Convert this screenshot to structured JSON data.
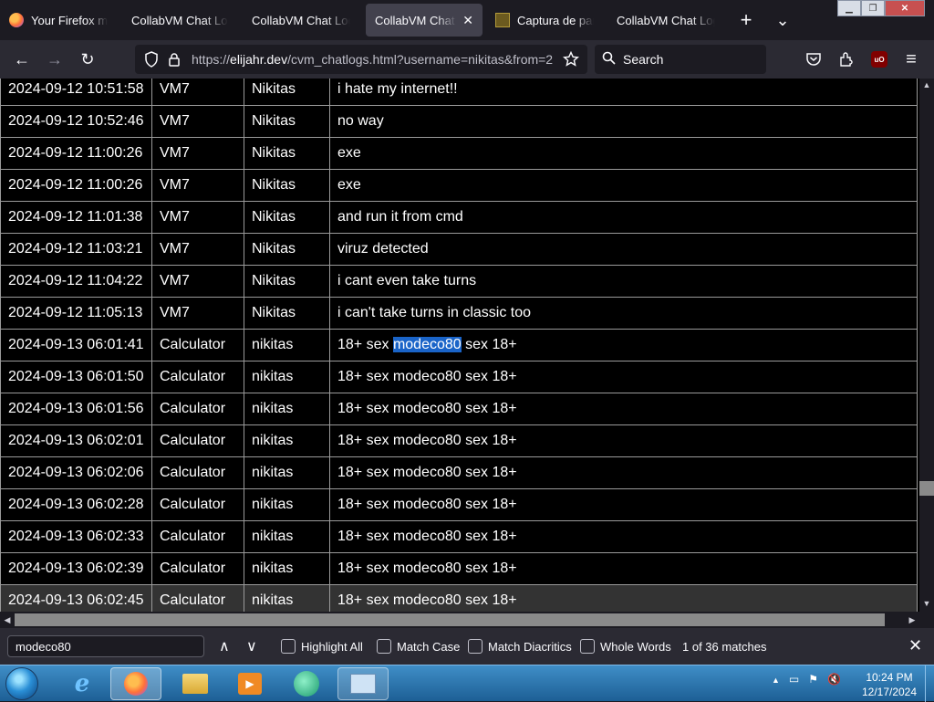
{
  "window": {
    "minimize_glyph": "▁",
    "restore_glyph": "❐",
    "close_glyph": "✕"
  },
  "tabs": [
    {
      "label": "Your Firefox may",
      "icon": "firefox-icon",
      "active": false
    },
    {
      "label": "CollabVM Chat Logs",
      "icon": "none",
      "active": false
    },
    {
      "label": "CollabVM Chat Logs",
      "icon": "none",
      "active": false
    },
    {
      "label": "CollabVM Chat Lo",
      "icon": "none",
      "active": true
    },
    {
      "label": "Captura de panta",
      "icon": "image-icon",
      "active": false
    },
    {
      "label": "CollabVM Chat Logs",
      "icon": "none",
      "active": false
    }
  ],
  "toolbar": {
    "new_tab_glyph": "+",
    "list_tabs_glyph": "⌄",
    "back_glyph": "←",
    "forward_glyph": "→",
    "reload_glyph": "↻",
    "url_prefix": "https://",
    "url_host": "elijahr.dev",
    "url_path": "/cvm_chatlogs.html?username=nikitas&from=2",
    "search_placeholder": "Search",
    "ublock_label": "uO",
    "menu_glyph": "≡"
  },
  "table": {
    "rows": [
      [
        "2024-09-12 10:51:58",
        "VM7",
        "Nikitas",
        "i hate my internet!!"
      ],
      [
        "2024-09-12 10:52:46",
        "VM7",
        "Nikitas",
        "no way"
      ],
      [
        "2024-09-12 11:00:26",
        "VM7",
        "Nikitas",
        "exe"
      ],
      [
        "2024-09-12 11:00:26",
        "VM7",
        "Nikitas",
        "exe"
      ],
      [
        "2024-09-12 11:01:38",
        "VM7",
        "Nikitas",
        "and run it from cmd"
      ],
      [
        "2024-09-12 11:03:21",
        "VM7",
        "Nikitas",
        "viruz detected"
      ],
      [
        "2024-09-12 11:04:22",
        "VM7",
        "Nikitas",
        "i cant even take turns"
      ],
      [
        "2024-09-12 11:05:13",
        "VM7",
        "Nikitas",
        "i can't take turns in classic too"
      ],
      [
        "2024-09-13 06:01:41",
        "Calculator",
        "nikitas",
        "18+ sex modeco80 sex 18+"
      ],
      [
        "2024-09-13 06:01:50",
        "Calculator",
        "nikitas",
        "18+ sex modeco80 sex 18+"
      ],
      [
        "2024-09-13 06:01:56",
        "Calculator",
        "nikitas",
        "18+ sex modeco80 sex 18+"
      ],
      [
        "2024-09-13 06:02:01",
        "Calculator",
        "nikitas",
        "18+ sex modeco80 sex 18+"
      ],
      [
        "2024-09-13 06:02:06",
        "Calculator",
        "nikitas",
        "18+ sex modeco80 sex 18+"
      ],
      [
        "2024-09-13 06:02:28",
        "Calculator",
        "nikitas",
        "18+ sex modeco80 sex 18+"
      ],
      [
        "2024-09-13 06:02:33",
        "Calculator",
        "nikitas",
        "18+ sex modeco80 sex 18+"
      ],
      [
        "2024-09-13 06:02:39",
        "Calculator",
        "nikitas",
        "18+ sex modeco80 sex 18+"
      ],
      [
        "2024-09-13 06:02:45",
        "Calculator",
        "nikitas",
        "18+ sex modeco80 sex 18+"
      ]
    ],
    "highlight_row": 8,
    "highlight_term": "modeco80",
    "hover_row": 16
  },
  "scroll": {
    "vertical_position": 0.79
  },
  "findbar": {
    "query": "modeco80",
    "prev_glyph": "∧",
    "next_glyph": "∨",
    "highlight_all": "Highlight All",
    "match_case": "Match Case",
    "match_diacritics": "Match Diacritics",
    "whole_words": "Whole Words",
    "status": "1 of 36 matches",
    "close_glyph": "✕"
  },
  "taskbar": {
    "apps": [
      "internet-explorer-icon",
      "firefox-icon",
      "file-explorer-icon",
      "media-player-icon",
      "app-icon",
      "control-panel-icon"
    ],
    "tray_glyphs": [
      "▲",
      "⚑",
      "🔇"
    ],
    "time": "10:24 PM",
    "date": "12/17/2024"
  },
  "colors": {
    "tab_bar": "#1c1b22",
    "toolbar": "#2b2a33",
    "page_background": "#000000",
    "table_border": "#9a9a9a",
    "find_highlight": "#1a64c8",
    "taskbar": "#2a78b4"
  }
}
